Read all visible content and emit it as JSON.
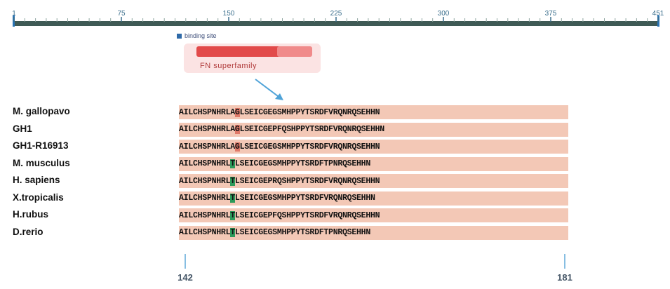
{
  "ruler": {
    "ticks": [
      "1",
      "75",
      "150",
      "225",
      "300",
      "375",
      "451"
    ]
  },
  "legend": {
    "text": "binding site"
  },
  "domain": {
    "label": "FN superfamily"
  },
  "alignment": {
    "rows": [
      {
        "species": "M. gallopavo",
        "pre": "AILCHSPNHRLA",
        "mut": "G",
        "post": "LSEICGEGSMHPPYTSRDFVRQNRQSEHHN",
        "mut_type": "ancestral"
      },
      {
        "species": "GH1",
        "pre": "AILCHSPNHRLA",
        "mut": "G",
        "post": "LSEICGEPFQSHPPYTSRDFVRQNRQSEHHN",
        "mut_type": "ancestral"
      },
      {
        "species": "GH1-R16913",
        "pre": "AILCHSPNHRLA",
        "mut": "G",
        "post": "LSEICGEGSMHPPYTSRDFVRQNRQSEHHN",
        "mut_type": "ancestral"
      },
      {
        "species": "M. musculus",
        "pre": "AILCHSPNHRL",
        "mut": "T",
        "post": "LSEICGEGSMHPPYTSRDFTPNRQSEHHN",
        "mut_type": "variant"
      },
      {
        "species": "H. sapiens",
        "pre": "AILCHSPNHRL",
        "mut": "T",
        "post": "LSEICGEPRQSHPPYTSRDFVRQNRQSEHHN",
        "mut_type": "variant"
      },
      {
        "species": "X.tropicalis",
        "pre": "AILCHSPNHRL",
        "mut": "T",
        "post": "LSEICGEGSMHPPYTSRDFVRQNRQSEHHN",
        "mut_type": "variant"
      },
      {
        "species": "H.rubus",
        "pre": "AILCHSPNHRL",
        "mut": "T",
        "post": "LSEICGEPFQSHPPYTSRDFVRQNRQSEHHN",
        "mut_type": "variant"
      },
      {
        "species": "D.rerio",
        "pre": "AILCHSPNHRL",
        "mut": "T",
        "post": "LSEICGEGSMHPPYTSRDFTPNRQSEHHN",
        "mut_type": "variant"
      }
    ],
    "start_label": "142",
    "end_label": "181"
  },
  "colors": {
    "ruler": "#3f5a55",
    "ruler_end": "#2a74b5",
    "domain_bar": "#e24a4a",
    "row_background": "#f3c8b6",
    "mutation_ancestral": "#e07a6a",
    "mutation_variant": "#2c9a5a",
    "arrow": "#4fa3d8",
    "position_line": "#5fa8d8"
  },
  "icons": {
    "arrow": "arrow-down-right-icon",
    "legend_marker": "square-swatch-icon"
  }
}
